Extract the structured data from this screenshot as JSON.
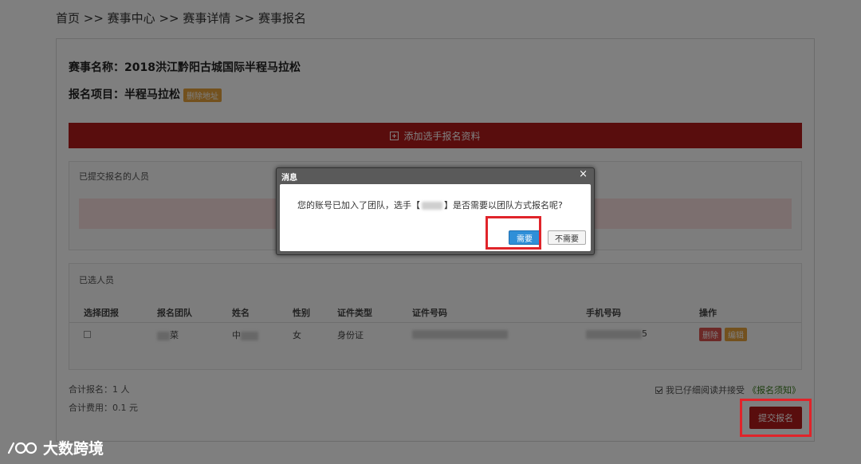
{
  "breadcrumb": "首页 >> 赛事中心 >> 赛事详情 >> 赛事报名",
  "race": {
    "name_line": "赛事名称：2018洪江黔阳古城国际半程马拉松",
    "item_line": "报名项目：半程马拉松",
    "item_badge": "删除地址"
  },
  "add_bar": {
    "label": "添加选手报名资料"
  },
  "submitted": {
    "title": "已提交报名的人员"
  },
  "selected": {
    "title": "已选人员",
    "columns": [
      "选择团报",
      "报名团队",
      "姓名",
      "性别",
      "证件类型",
      "证件号码",
      "手机号码",
      "操作"
    ],
    "row": {
      "team": "菜",
      "name": "中",
      "gender": "女",
      "id_type": "身份证",
      "phone_suffix": "5",
      "delete_label": "删除",
      "edit_label": "编辑"
    }
  },
  "summary": {
    "count": "合计报名：1 人",
    "fee": "合计费用：0.1 元"
  },
  "agree": {
    "text": "我已仔细阅读并接受",
    "link": "《报名须知》"
  },
  "submit_label": "提交报名",
  "dialog": {
    "title": "消息",
    "close": "×",
    "msg_before": "您的账号已加入了团队，选手【",
    "msg_after": "】是否需要以团队方式报名呢?",
    "need_label": "需要",
    "noneed_label": "不需要"
  },
  "watermark": {
    "text": "大数跨境"
  },
  "colors": {
    "brand_red": "#b31b1b",
    "highlight": "#e0242a",
    "primary_blue": "#2f8fd8",
    "badge_orange": "#e6a23c"
  }
}
